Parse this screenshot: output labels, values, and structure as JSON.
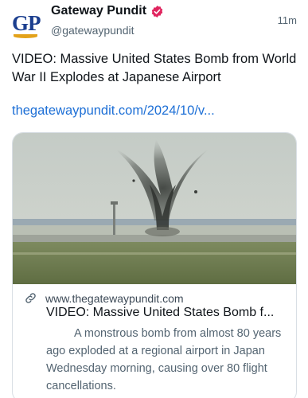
{
  "author": {
    "name": "Gateway Pundit",
    "handle": "@gatewaypundit",
    "avatar_text": "GP",
    "verified": true
  },
  "post": {
    "timestamp": "11m",
    "text": "VIDEO: Massive United States Bomb from World War II Explodes at Japanese Airport",
    "link": "thegatewaypundit.com/2024/10/v..."
  },
  "card": {
    "domain": "www.thegatewaypundit.com",
    "title": "VIDEO: Massive United States Bomb f...",
    "description": "A monstrous bomb from almost 80 years ago exploded at a regional airport in Japan Wednesday morning, causing over 80 flight cancellations.",
    "icon": "link-icon"
  },
  "colors": {
    "link": "#1d6fd6",
    "verified_badge": "#e0245e",
    "secondary_text": "#536471",
    "brand_blue": "#1c3f8f",
    "brand_gold": "#e3a21a"
  }
}
